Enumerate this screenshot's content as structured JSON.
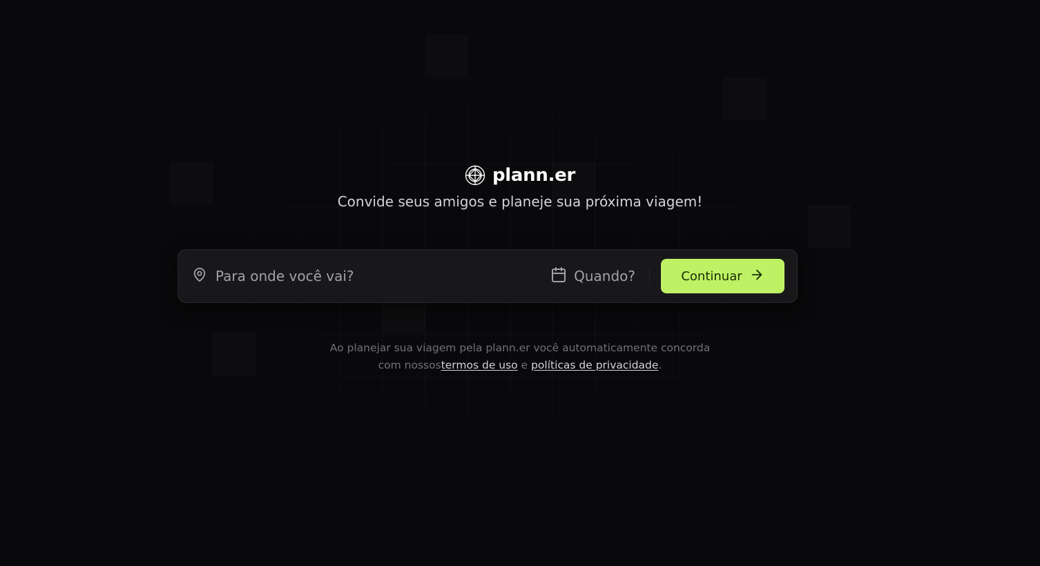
{
  "brand": {
    "name": "plann.er",
    "logo_icon": "globe-icon"
  },
  "tagline": "Convide seus amigos e planeje sua próxima viagem!",
  "search": {
    "destination_placeholder": "Para onde você vai?",
    "destination_value": "",
    "destination_icon": "map-pin-icon",
    "date_label": "Quando?",
    "date_icon": "calendar-icon",
    "continue_label": "Continuar",
    "continue_icon": "arrow-right-icon"
  },
  "legal": {
    "line1": "Ao planejar sua viagem pela plann.er você automaticamente concorda",
    "line2_prefix": "com nossos",
    "terms_link": "termos de uso",
    "conjunction": " e ",
    "privacy_link": "políticas de privacidade",
    "suffix": "."
  },
  "colors": {
    "background": "#09090b",
    "accent": "#bef264",
    "surface": "#18181b"
  }
}
